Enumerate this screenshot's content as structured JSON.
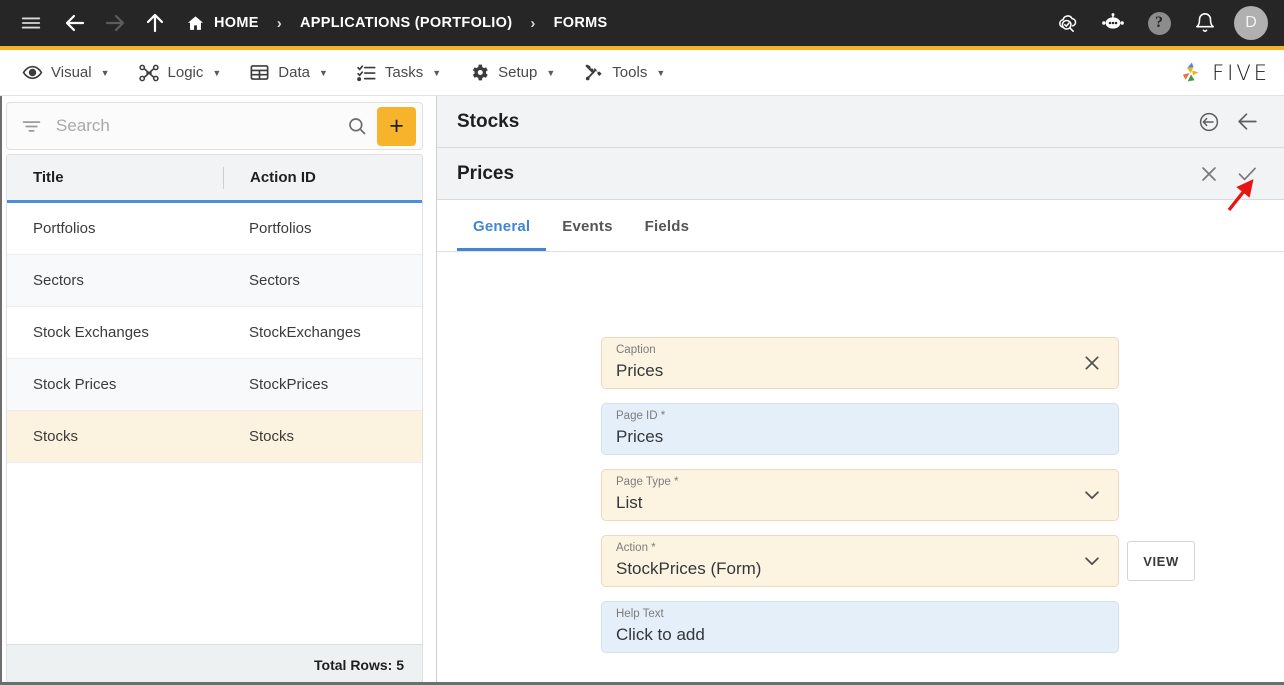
{
  "topbar": {
    "icons": {
      "menu": "hamburger-icon",
      "back": "back-arrow-icon",
      "forward": "forward-arrow-icon",
      "up": "up-arrow-icon",
      "home": "home-icon",
      "cloud_check": "cloud-check-icon",
      "chat_bot": "chat-bot-icon",
      "help": "help-icon",
      "bell": "notification-bell-icon"
    },
    "breadcrumb": [
      {
        "label": "HOME",
        "icon": "home-icon"
      },
      {
        "label": "APPLICATIONS (PORTFOLIO)"
      },
      {
        "label": "FORMS"
      }
    ],
    "separator": "›",
    "help_glyph": "?",
    "avatar_initial": "D",
    "accent_color": "#f5b128",
    "background_color": "#262626"
  },
  "menubar": {
    "items": [
      {
        "label": "Visual",
        "icon": "eye-icon"
      },
      {
        "label": "Logic",
        "icon": "logic-nodes-icon"
      },
      {
        "label": "Data",
        "icon": "table-grid-icon"
      },
      {
        "label": "Tasks",
        "icon": "task-list-icon"
      },
      {
        "label": "Setup",
        "icon": "gear-icon"
      },
      {
        "label": "Tools",
        "icon": "tools-icon"
      }
    ],
    "caret": "▼",
    "brand": "FIVE"
  },
  "left_panel": {
    "search": {
      "placeholder": "Search",
      "value": ""
    },
    "filter_icon": "filter-icon",
    "search_icon": "search-icon",
    "add_button_label": "+",
    "columns": [
      "Title",
      "Action ID"
    ],
    "rows": [
      {
        "title": "Portfolios",
        "action_id": "Portfolios"
      },
      {
        "title": "Sectors",
        "action_id": "Sectors"
      },
      {
        "title": "Stock Exchanges",
        "action_id": "StockExchanges"
      },
      {
        "title": "Stock Prices",
        "action_id": "StockPrices"
      },
      {
        "title": "Stocks",
        "action_id": "Stocks"
      }
    ],
    "selected_row_index": 4,
    "footer": "Total Rows: 5"
  },
  "right_panel": {
    "header": {
      "title": "Stocks",
      "icons": {
        "revert": "revert-circle-arrow-icon",
        "back": "back-arrow-icon"
      }
    },
    "subheader": {
      "title": "Prices",
      "icons": {
        "close": "close-x-icon",
        "confirm": "check-icon"
      }
    },
    "tabs": [
      {
        "label": "General",
        "active": true
      },
      {
        "label": "Events",
        "active": false
      },
      {
        "label": "Fields",
        "active": false
      }
    ],
    "fields": [
      {
        "label": "Caption",
        "value": "Prices",
        "style": "cream",
        "action_icon": "clear-x-icon"
      },
      {
        "label": "Page ID *",
        "value": "Prices",
        "style": "blue",
        "action_icon": ""
      },
      {
        "label": "Page Type *",
        "value": "List",
        "style": "cream",
        "action_icon": "chevron-down-icon"
      },
      {
        "label": "Action *",
        "value": "StockPrices (Form)",
        "style": "cream",
        "action_icon": "chevron-down-icon"
      },
      {
        "label": "Help Text",
        "value": "Click to add",
        "style": "blue",
        "action_icon": ""
      }
    ],
    "view_button_label": "VIEW"
  },
  "annotation": {
    "arrow_color": "#e81313",
    "points_to": "confirm-check-icon"
  }
}
